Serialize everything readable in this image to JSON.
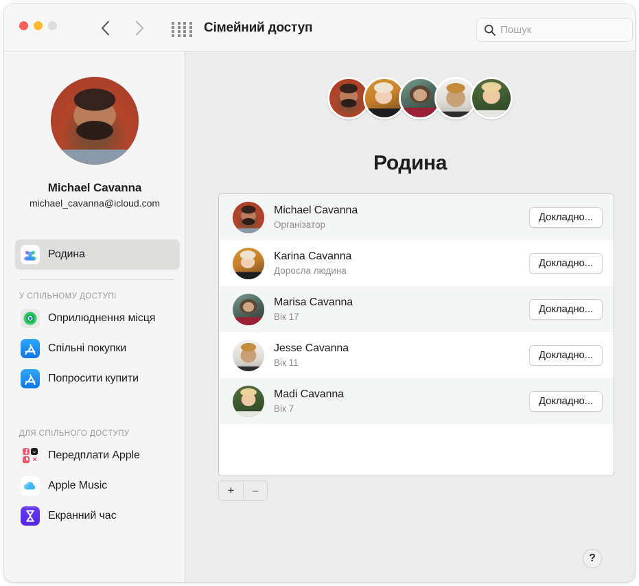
{
  "window": {
    "title": "Сімейний доступ",
    "traffic_lights": [
      "close-red",
      "minimize-yellow",
      "zoom-gray"
    ],
    "back_icon": "chevron-left-icon",
    "forward_icon": "chevron-right-icon",
    "grid_icon": "show-all-grid-icon"
  },
  "search": {
    "placeholder": "Пошук",
    "value": "",
    "icon": "search-icon"
  },
  "sidebar": {
    "account": {
      "name": "Michael Cavanna",
      "email": "michael_cavanna@icloud.com",
      "avatar": "user-avatar"
    },
    "selected_item": {
      "label": "Родина",
      "icon": "family-icon"
    },
    "sections": [
      {
        "header": "У СПІЛЬНОМУ ДОСТУПІ",
        "items": [
          {
            "label": "Оприлюднення місця",
            "icon": "find-my-icon"
          },
          {
            "label": "Спільні покупки",
            "icon": "app-store-icon"
          },
          {
            "label": "Попросити купити",
            "icon": "app-store-icon"
          }
        ]
      },
      {
        "header": "ДЛЯ СПІЛЬНОГО ДОСТУПУ",
        "items": [
          {
            "label": "Передплати Apple",
            "icon": "apple-subscriptions-icon"
          },
          {
            "label": "Apple Music",
            "icon": "icloud-icon"
          },
          {
            "label": "Екранний час",
            "icon": "screen-time-icon"
          }
        ]
      }
    ]
  },
  "main": {
    "title": "Родина",
    "avatar_cluster": [
      "michael-avatar",
      "karina-avatar",
      "marisa-avatar",
      "jesse-avatar",
      "madi-avatar"
    ],
    "members": [
      {
        "name": "Michael Cavanna",
        "role": "Організатор",
        "button": "Докладно...",
        "avatar": "michael-avatar"
      },
      {
        "name": "Karina Cavanna",
        "role": "Доросла людина",
        "button": "Докладно...",
        "avatar": "karina-avatar"
      },
      {
        "name": "Marisa Cavanna",
        "role": "Вік 17",
        "button": "Докладно...",
        "avatar": "marisa-avatar"
      },
      {
        "name": "Jesse Cavanna",
        "role": "Вік 11",
        "button": "Докладно...",
        "avatar": "jesse-avatar"
      },
      {
        "name": "Madi Cavanna",
        "role": "Вік 7",
        "button": "Докладно...",
        "avatar": "madi-avatar"
      }
    ],
    "add_button": "+",
    "remove_button": "–",
    "help_button": "?"
  },
  "colors": {
    "window_bg": "#ececec",
    "sidebar_bg": "#f5f5f5",
    "toolbar_bg": "#f7f7f7",
    "list_bg": "#ffffff",
    "row_stripe": "#f4f5f5",
    "text_primary": "#1d1d1f",
    "text_secondary": "#8d8d92",
    "selection": "#dededd",
    "close_red": "#ff5f57",
    "minimize_yellow": "#febc2e",
    "zoom_gray": "#dddddd"
  }
}
